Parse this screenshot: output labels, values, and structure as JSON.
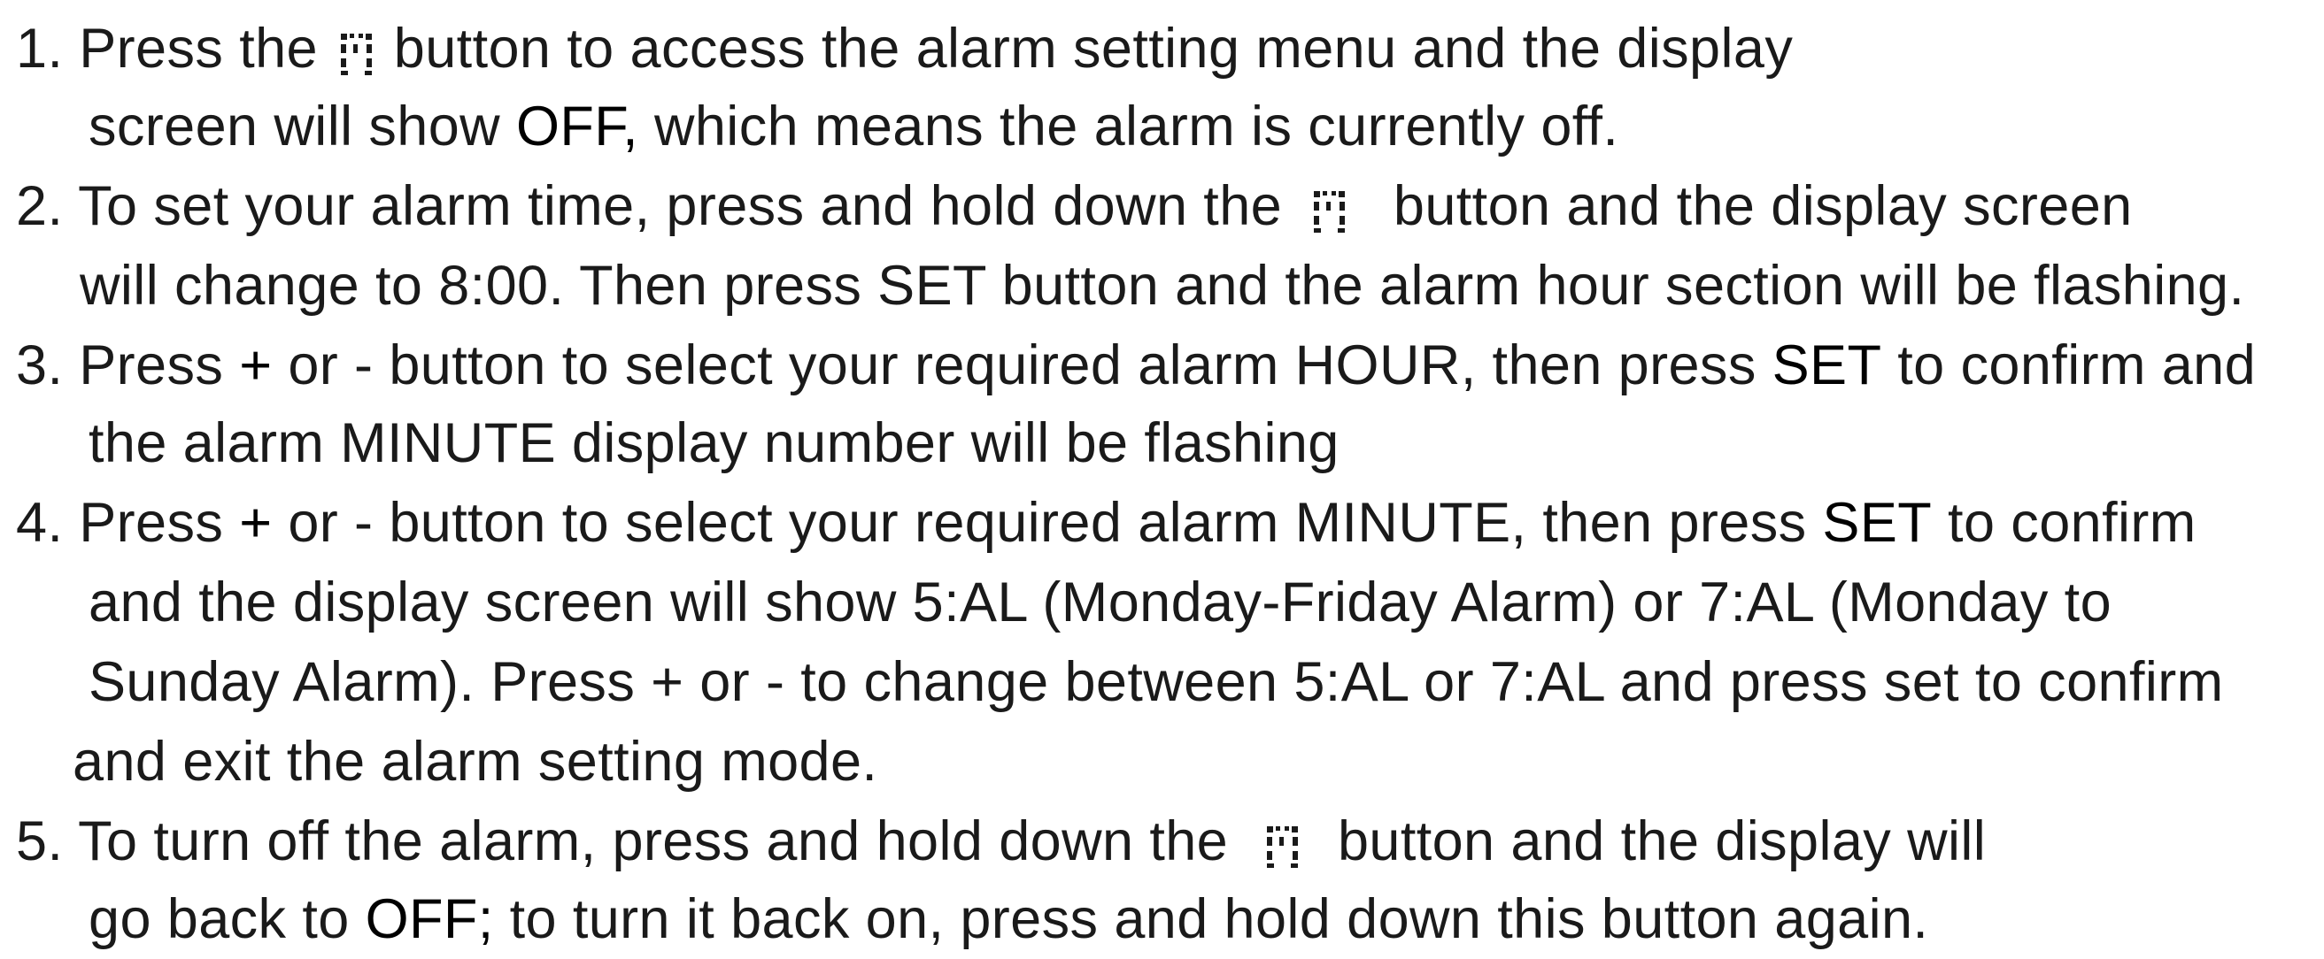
{
  "items": [
    {
      "number": "1.",
      "line1_before_icon": "Press the",
      "icon": "alarm-bell-icon",
      "line1_after_icon": "button to access the alarm setting menu and the display",
      "line2_a": "screen will show",
      "line2_bold": "OFF,",
      "line2_b": "which means the alarm is currently off."
    },
    {
      "number": "2.",
      "line1_before_icon": "To set your alarm time, press and hold down the",
      "icon": "alarm-bell-icon",
      "line1_after_icon": "button and the display screen",
      "line2": "will  change to 8:00. Then press SET button and the alarm hour section will be flashing."
    },
    {
      "number": "3.",
      "line1_a": "Press",
      "line1_plus": "+",
      "line1_b": "or - button to select your required alarm HOUR, then press",
      "line1_bold": "SET",
      "line1_c": "to confirm and",
      "line2": "the alarm MINUTE display number will be flashing"
    },
    {
      "number": "4.",
      "line1_a": "Press",
      "line1_plus": "+",
      "line1_b": "or - button to select your required alarm MINUTE, then press",
      "line1_bold": "SET",
      "line1_c": "to confirm",
      "line2": "and the display screen will show 5:AL (Monday-Friday Alarm) or 7:AL (Monday to",
      "line3": "Sunday Alarm). Press + or - to change between 5:AL or 7:AL and press set to confirm",
      "line4": "and exit the alarm setting mode."
    },
    {
      "number": "5.",
      "line1_before_icon": "To turn off the alarm, press and hold down the",
      "icon": "alarm-bell-icon",
      "line1_after_icon": "button and the display will",
      "line2_a": "go back to",
      "line2_bold": "OFF;",
      "line2_b": "to turn it back on, press and hold down this button again."
    }
  ]
}
